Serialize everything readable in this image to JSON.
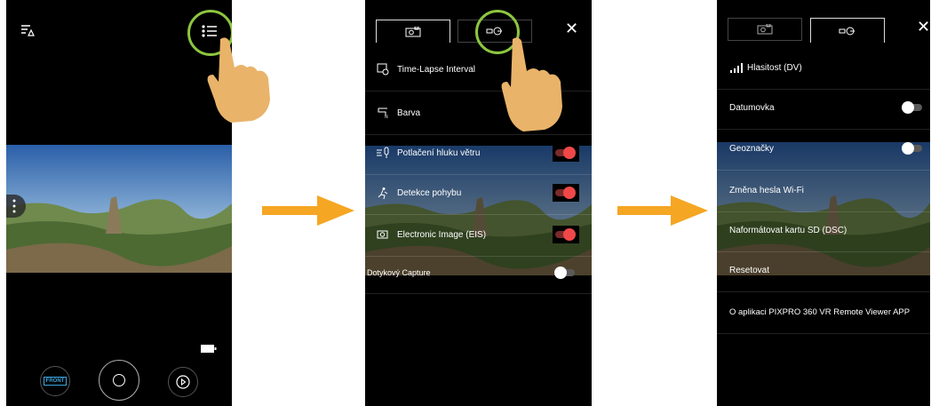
{
  "screen1": {
    "front_label": "FRONT"
  },
  "screen2": {
    "rows": [
      {
        "label": "Time-Lapse Interval",
        "icon": "timelapse-icon",
        "toggle": null
      },
      {
        "label": "Barva",
        "icon": "color-icon",
        "toggle": null
      },
      {
        "label": "Potlačení hluku větru",
        "icon": "wind-noise-icon",
        "toggle": "on"
      },
      {
        "label": "Detekce pohybu",
        "icon": "motion-detect-icon",
        "toggle": "on"
      },
      {
        "label": "Electronic Image (EIS)",
        "icon": "eis-icon",
        "toggle": "on"
      },
      {
        "label": "Dotykový Capture",
        "icon": "",
        "toggle": "off"
      }
    ]
  },
  "screen3": {
    "rows": [
      {
        "label": "Hlasitost (DV)",
        "icon": "volume-icon",
        "toggle": null
      },
      {
        "label": "Datumovka",
        "icon": "",
        "toggle": "off"
      },
      {
        "label": "Geoznačky",
        "icon": "",
        "toggle": "off"
      },
      {
        "label": "Změna hesla Wi-Fi",
        "icon": "",
        "toggle": null
      },
      {
        "label": "Naformátovat kartu SD (DSC)",
        "icon": "",
        "toggle": null
      },
      {
        "label": "Resetovat",
        "icon": "",
        "toggle": null
      },
      {
        "label": "O aplikaci PIXPRO 360 VR Remote Viewer APP",
        "icon": "",
        "toggle": null
      }
    ]
  },
  "colors": {
    "highlight_ring": "#8cc63f",
    "arrow": "#f5a623",
    "toggle_on": "#f04848",
    "hand": "#e9b36a"
  }
}
